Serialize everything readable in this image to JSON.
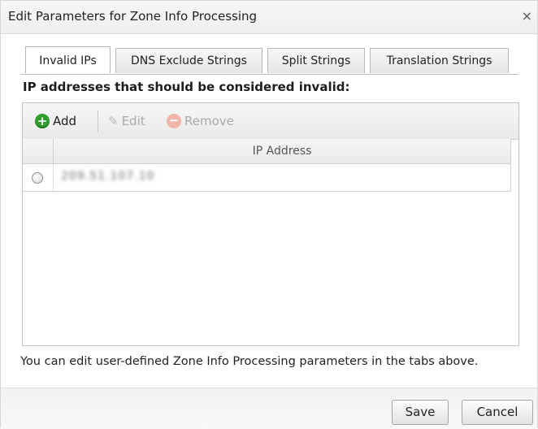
{
  "dialog": {
    "title": "Edit Parameters for Zone Info Processing",
    "close_glyph": "×"
  },
  "tabs": [
    {
      "label": "Invalid IPs",
      "active": true
    },
    {
      "label": "DNS Exclude Strings",
      "active": false
    },
    {
      "label": "Split Strings",
      "active": false
    },
    {
      "label": "Translation Strings",
      "active": false
    }
  ],
  "section": {
    "heading": "IP addresses that should be considered invalid:"
  },
  "toolbar": {
    "add_label": "Add",
    "add_icon": "add-circle-icon",
    "edit_label": "Edit",
    "edit_icon": "pencil-icon",
    "remove_label": "Remove",
    "remove_icon": "remove-circle-icon",
    "edit_enabled": false,
    "remove_enabled": false
  },
  "grid": {
    "columns": [
      "IP Address"
    ],
    "rows": [
      {
        "ip": "209.51.107.10",
        "selected": false,
        "obscured": true
      }
    ]
  },
  "footnote": "You can edit user-defined Zone Info Processing parameters in the tabs above.",
  "buttons": {
    "save_label": "Save",
    "cancel_label": "Cancel"
  },
  "colors": {
    "add_icon": "#2f9e2f",
    "remove_icon": "#f0b5a9",
    "disabled_text": "#a9a9a9"
  }
}
